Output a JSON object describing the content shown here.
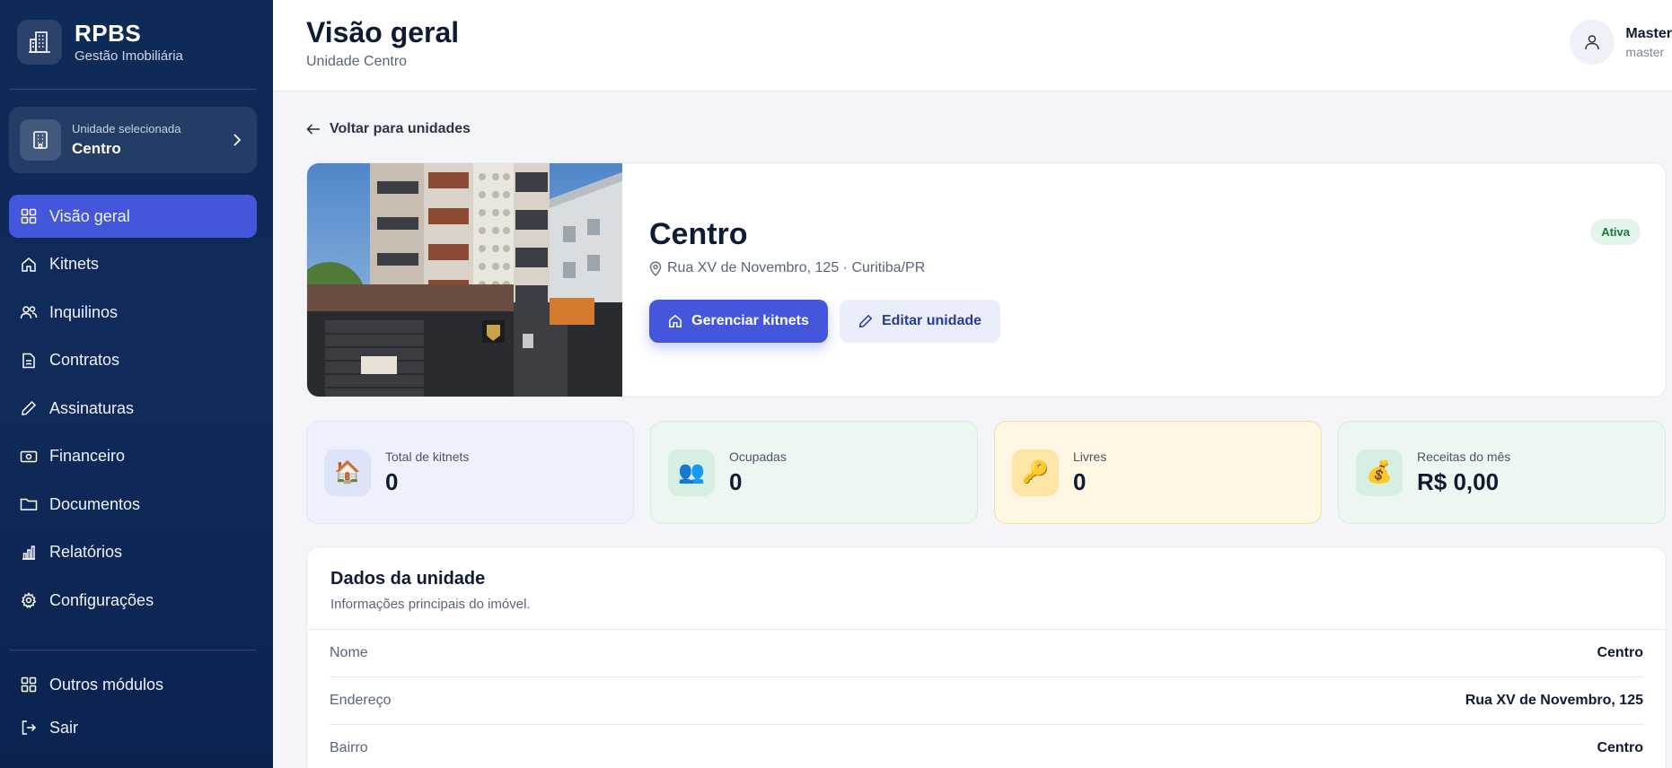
{
  "brand": {
    "title": "RPBS",
    "subtitle": "Gestão Imobiliária"
  },
  "unit_selector": {
    "label": "Unidade selecionada",
    "value": "Centro"
  },
  "nav": {
    "items": [
      {
        "label": "Visão geral",
        "icon": "grid-icon",
        "active": true
      },
      {
        "label": "Kitnets",
        "icon": "home-icon"
      },
      {
        "label": "Inquilinos",
        "icon": "users-icon"
      },
      {
        "label": "Contratos",
        "icon": "file-text-icon"
      },
      {
        "label": "Assinaturas",
        "icon": "pen-icon"
      },
      {
        "label": "Financeiro",
        "icon": "money-icon"
      },
      {
        "label": "Documentos",
        "icon": "folder-icon"
      },
      {
        "label": "Relatórios",
        "icon": "bar-chart-icon"
      },
      {
        "label": "Configurações",
        "icon": "gear-icon"
      }
    ],
    "bottom": [
      {
        "label": "Outros módulos",
        "icon": "grid-icon"
      },
      {
        "label": "Sair",
        "icon": "logout-icon"
      }
    ]
  },
  "header": {
    "title": "Visão geral",
    "subtitle": "Unidade Centro"
  },
  "user": {
    "name": "Master",
    "role": "master"
  },
  "back_link": "Voltar para unidades",
  "unit": {
    "name": "Centro",
    "address": "Rua XV de Novembro, 125 · Curitiba/PR",
    "status": "Ativa",
    "manage_button": "Gerenciar kitnets",
    "edit_button": "Editar unidade"
  },
  "stats": [
    {
      "label": "Total de kitnets",
      "value": "0",
      "icon": "house-emoji",
      "glyph": "🏠",
      "bg": "#eef1fd",
      "border": "#dfe4f7",
      "icon_bg": "#dde3f8"
    },
    {
      "label": "Ocupadas",
      "value": "0",
      "icon": "people-emoji",
      "glyph": "👥",
      "bg": "#ebf7f0",
      "border": "#d7ecdf",
      "icon_bg": "#d6efe0"
    },
    {
      "label": "Livres",
      "value": "0",
      "icon": "key-emoji",
      "glyph": "🔑",
      "bg": "#fff6e3",
      "border": "#f2dfa9",
      "icon_bg": "#fde5a8"
    },
    {
      "label": "Receitas do mês",
      "value": "R$ 0,00",
      "icon": "money-bag-emoji",
      "glyph": "💰",
      "bg": "#ebf7f0",
      "border": "#d7ecdf",
      "icon_bg": "#d6efe0"
    }
  ],
  "details": {
    "title": "Dados da unidade",
    "subtitle": "Informações principais do imóvel.",
    "rows": [
      {
        "key": "Nome",
        "value": "Centro"
      },
      {
        "key": "Endereço",
        "value": "Rua XV de Novembro, 125"
      },
      {
        "key": "Bairro",
        "value": "Centro"
      }
    ]
  },
  "colors": {
    "sidebar": "#0e2a56",
    "accent": "#4457dc",
    "status_bg": "#e3f5ea",
    "status_text": "#187a3e"
  }
}
